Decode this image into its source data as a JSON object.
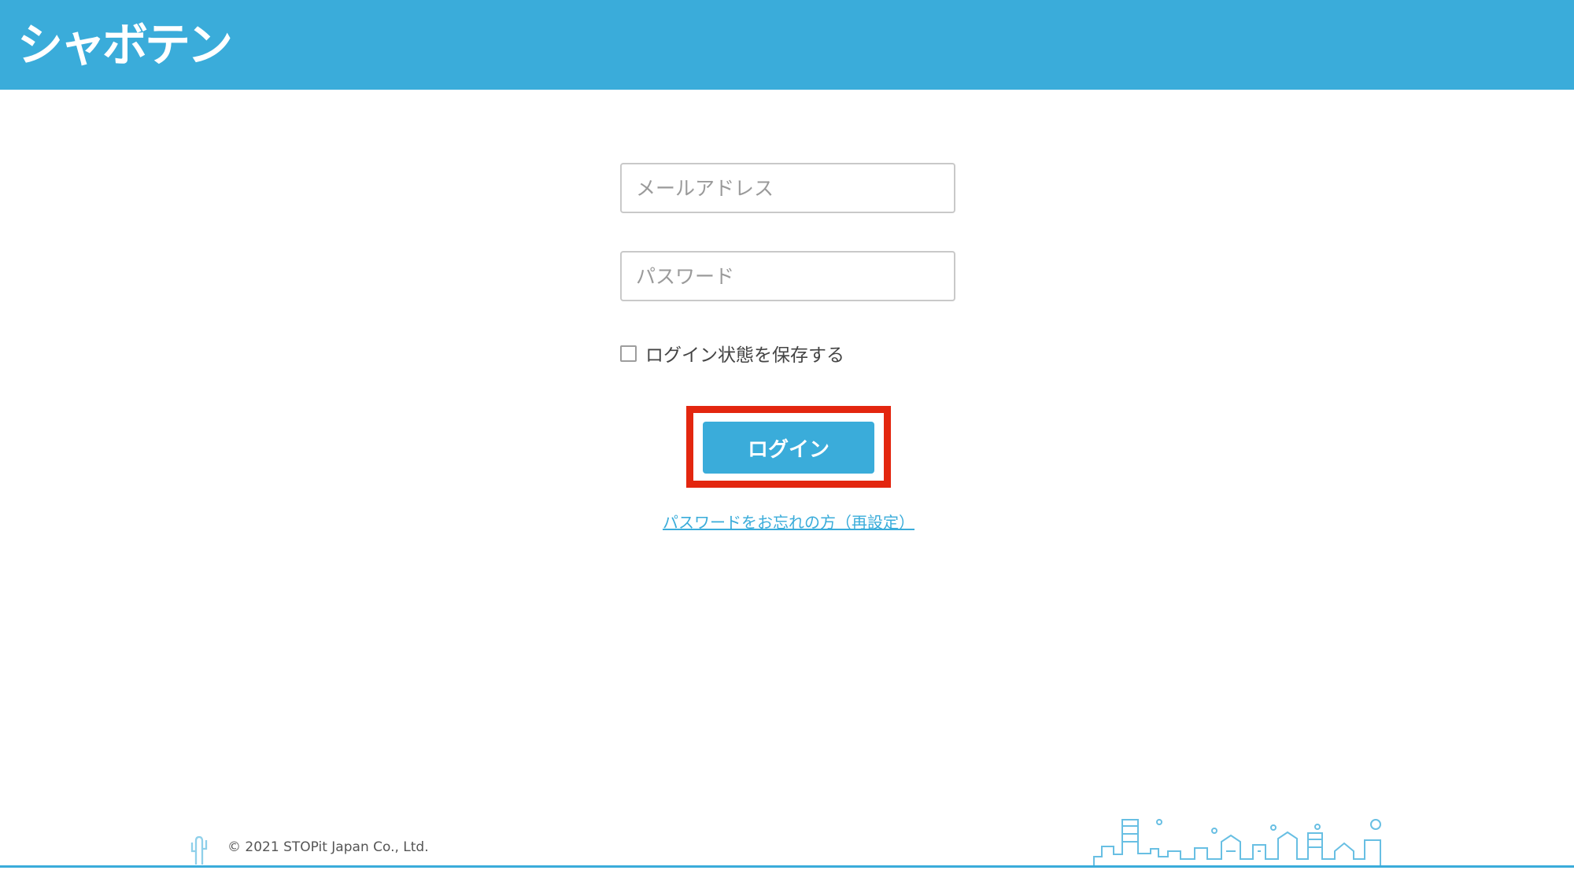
{
  "header": {
    "logo_text": "シャボテン",
    "background_color": "#3aacda"
  },
  "login_form": {
    "email_placeholder": "メールアドレス",
    "email_value": "",
    "password_placeholder": "パスワード",
    "password_value": "",
    "remember_label": "ログイン状態を保存する",
    "remember_checked": false,
    "login_button_label": "ログイン",
    "forgot_password_link": "パスワードをお忘れの方（再設定）",
    "highlight_color": "#e3260f"
  },
  "footer": {
    "copyright": "© 2021 STOPit Japan Co., Ltd.",
    "cactus_icon": "cactus-icon",
    "cityscape_icon": "cityscape-illustration"
  }
}
